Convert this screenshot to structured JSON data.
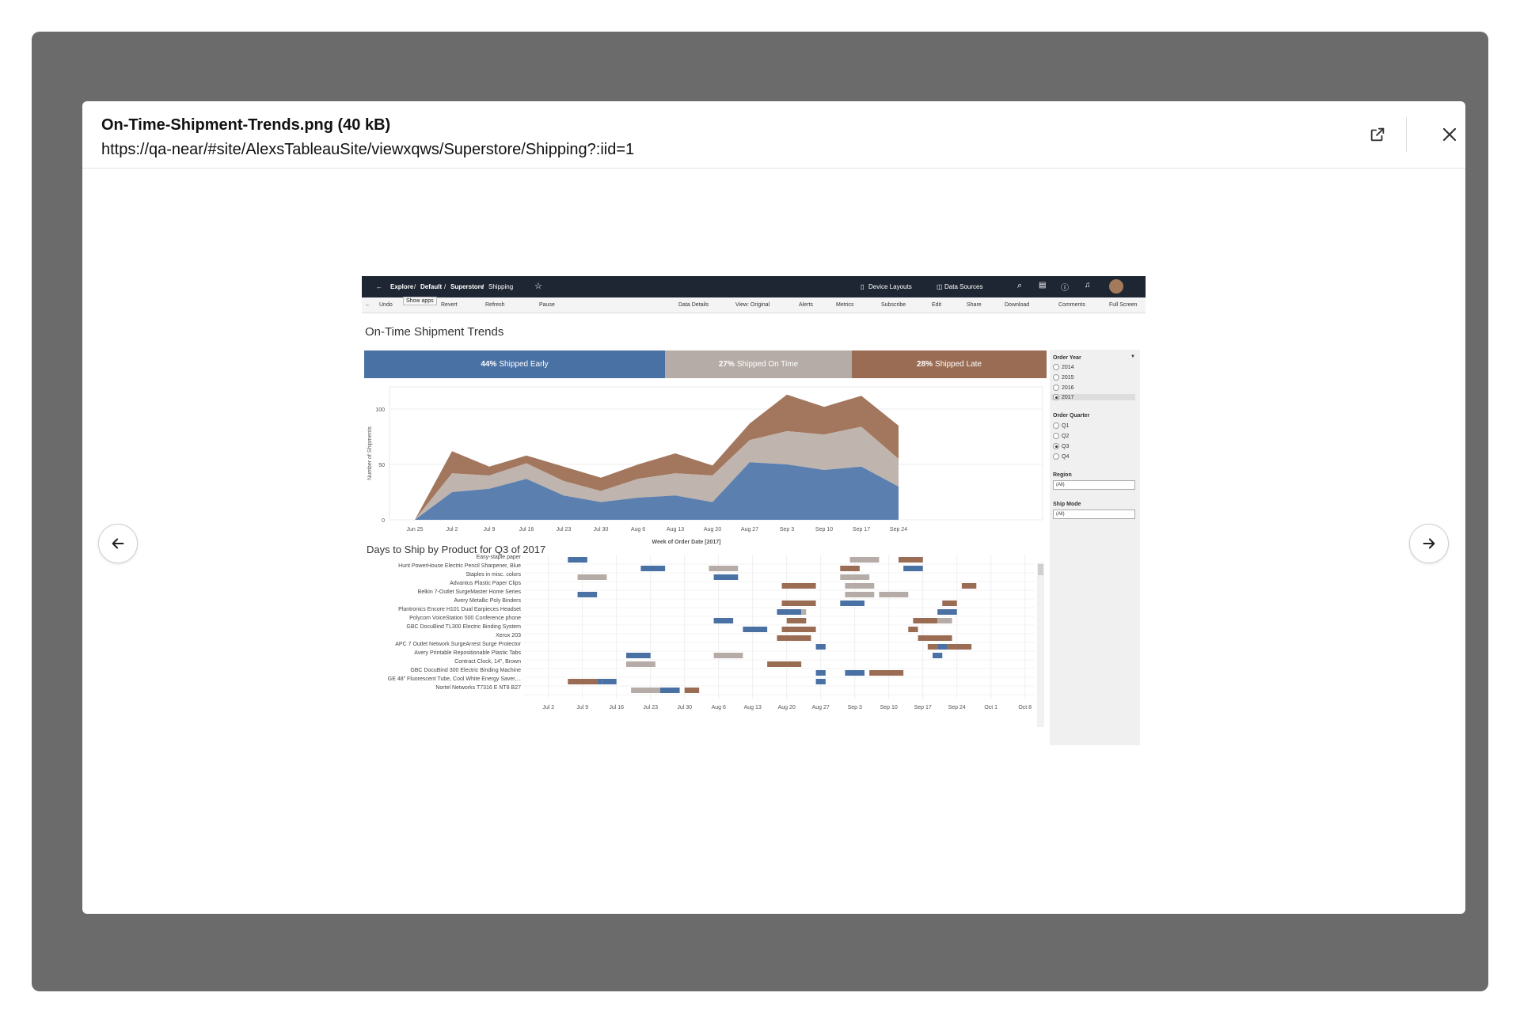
{
  "modal": {
    "file_title": "On-Time-Shipment-Trends.png (40 kB)",
    "file_url": "https://qa-near/#site/AlexsTableauSite/viewxqws/Superstore/Shipping?:iid=1"
  },
  "tableau": {
    "breadcrumb": [
      "Explore",
      "Default",
      "Superstore",
      "Shipping"
    ],
    "nav_right": [
      "Device Layouts",
      "Data Sources"
    ],
    "toolbar_left": [
      "Undo",
      "Revert",
      "Refresh",
      "Pause"
    ],
    "toolbar_right": [
      "Data Details",
      "View: Original",
      "Alerts",
      "Metrics",
      "Subscribe",
      "Edit",
      "Share",
      "Download",
      "Comments",
      "Full Screen"
    ],
    "tooltip": "Show apps",
    "view_title": "On-Time Shipment Trends",
    "kpis": [
      {
        "pct": "44%",
        "label": "Shipped Early",
        "color": "#4a71a4"
      },
      {
        "pct": "27%",
        "label": "Shipped On Time",
        "color": "#b6aca7"
      },
      {
        "pct": "28%",
        "label": "Shipped Late",
        "color": "#9a6c54"
      }
    ],
    "filters": {
      "order_year": {
        "label": "Order Year",
        "options": [
          "2014",
          "2015",
          "2016",
          "2017"
        ],
        "selected": "2017"
      },
      "order_quarter": {
        "label": "Order Quarter",
        "options": [
          "Q1",
          "Q2",
          "Q3",
          "Q4"
        ],
        "selected": "Q3"
      },
      "region": {
        "label": "Region",
        "value": "(All)"
      },
      "ship_mode": {
        "label": "Ship Mode",
        "value": "(All)"
      }
    },
    "gantt_title": "Days to Ship by Product for Q3 of 2017"
  },
  "chart_data": [
    {
      "type": "area",
      "xlabel": "Week of Order Date [2017]",
      "ylabel": "Number of Shipments",
      "ylim": [
        0,
        120
      ],
      "yticks": [
        0,
        50,
        100
      ],
      "x": [
        "Jun 25",
        "Jul 2",
        "Jul 9",
        "Jul 16",
        "Jul 23",
        "Jul 30",
        "Aug 6",
        "Aug 13",
        "Aug 20",
        "Aug 27",
        "Sep 3",
        "Sep 10",
        "Sep 17",
        "Sep 24"
      ],
      "stacked": true,
      "series": [
        {
          "name": "Shipped Early",
          "color": "#5b80b0",
          "values": [
            0,
            25,
            28,
            37,
            22,
            16,
            20,
            22,
            16,
            52,
            50,
            45,
            48,
            30
          ]
        },
        {
          "name": "Shipped On Time",
          "color": "#bfb4ae",
          "values": [
            0,
            17,
            12,
            14,
            13,
            10,
            17,
            20,
            24,
            20,
            30,
            32,
            36,
            25
          ]
        },
        {
          "name": "Shipped Late",
          "color": "#a3775e",
          "values": [
            0,
            20,
            8,
            7,
            13,
            12,
            13,
            18,
            9,
            15,
            33,
            25,
            28,
            30
          ]
        }
      ]
    },
    {
      "type": "bar",
      "subtype": "gantt",
      "title": "Days to Ship by Product for Q3 of 2017",
      "x_ticks": [
        "Jul 2",
        "Jul 9",
        "Jul 16",
        "Jul 23",
        "Jul 30",
        "Aug 6",
        "Aug 13",
        "Aug 20",
        "Aug 27",
        "Sep 3",
        "Sep 10",
        "Sep 17",
        "Sep 24",
        "Oct 1",
        "Oct 8"
      ],
      "x_start": "2017-06-27",
      "x_end": "2017-10-10",
      "status_colors": {
        "early": "#4a71a4",
        "on_time": "#b6aca7",
        "late": "#9a6c54"
      },
      "rows": [
        {
          "product": "Easy-staple paper",
          "bars": [
            {
              "start": "2017-07-06",
              "end": "2017-07-10",
              "status": "early"
            },
            {
              "start": "2017-09-02",
              "end": "2017-09-08",
              "status": "on_time"
            },
            {
              "start": "2017-09-12",
              "end": "2017-09-17",
              "status": "late"
            }
          ]
        },
        {
          "product": "Hunt PowerHouse Electric Pencil Sharpener, Blue",
          "bars": [
            {
              "start": "2017-07-21",
              "end": "2017-07-26",
              "status": "early"
            },
            {
              "start": "2017-08-04",
              "end": "2017-08-10",
              "status": "on_time"
            },
            {
              "start": "2017-08-31",
              "end": "2017-09-04",
              "status": "late"
            },
            {
              "start": "2017-09-13",
              "end": "2017-09-17",
              "status": "early"
            }
          ]
        },
        {
          "product": "Staples in misc. colors",
          "bars": [
            {
              "start": "2017-07-08",
              "end": "2017-07-14",
              "status": "on_time"
            },
            {
              "start": "2017-08-05",
              "end": "2017-08-10",
              "status": "early"
            },
            {
              "start": "2017-08-31",
              "end": "2017-09-06",
              "status": "on_time"
            }
          ]
        },
        {
          "product": "Advantus Plastic Paper Clips",
          "bars": [
            {
              "start": "2017-08-19",
              "end": "2017-08-26",
              "status": "late"
            },
            {
              "start": "2017-09-01",
              "end": "2017-09-07",
              "status": "on_time"
            },
            {
              "start": "2017-09-25",
              "end": "2017-09-28",
              "status": "late"
            }
          ]
        },
        {
          "product": "Belkin 7-Outlet SurgeMaster Home Series",
          "bars": [
            {
              "start": "2017-07-08",
              "end": "2017-07-12",
              "status": "early"
            },
            {
              "start": "2017-09-01",
              "end": "2017-09-07",
              "status": "on_time"
            },
            {
              "start": "2017-09-08",
              "end": "2017-09-14",
              "status": "on_time"
            }
          ]
        },
        {
          "product": "Avery Metallic Poly Binders",
          "bars": [
            {
              "start": "2017-08-19",
              "end": "2017-08-26",
              "status": "late"
            },
            {
              "start": "2017-08-31",
              "end": "2017-09-05",
              "status": "early"
            },
            {
              "start": "2017-09-21",
              "end": "2017-09-24",
              "status": "late"
            }
          ]
        },
        {
          "product": "Plantronics Encore H101 Dual Earpieces Headset",
          "bars": [
            {
              "start": "2017-08-18",
              "end": "2017-08-23",
              "status": "early"
            },
            {
              "start": "2017-08-23",
              "end": "2017-08-24",
              "status": "on_time"
            },
            {
              "start": "2017-09-20",
              "end": "2017-09-24",
              "status": "early"
            }
          ]
        },
        {
          "product": "Polycom VoiceStation 500 Conference phone",
          "bars": [
            {
              "start": "2017-08-05",
              "end": "2017-08-09",
              "status": "early"
            },
            {
              "start": "2017-08-20",
              "end": "2017-08-24",
              "status": "late"
            },
            {
              "start": "2017-09-15",
              "end": "2017-09-20",
              "status": "late"
            },
            {
              "start": "2017-09-20",
              "end": "2017-09-23",
              "status": "on_time"
            }
          ]
        },
        {
          "product": "GBC DocuBind TL300 Electric Binding System",
          "bars": [
            {
              "start": "2017-08-11",
              "end": "2017-08-16",
              "status": "early"
            },
            {
              "start": "2017-08-19",
              "end": "2017-08-26",
              "status": "late"
            },
            {
              "start": "2017-09-14",
              "end": "2017-09-16",
              "status": "late"
            }
          ]
        },
        {
          "product": "Xerox 203",
          "bars": [
            {
              "start": "2017-08-18",
              "end": "2017-08-25",
              "status": "late"
            },
            {
              "start": "2017-09-16",
              "end": "2017-09-23",
              "status": "late"
            }
          ]
        },
        {
          "product": "APC 7 Outlet Network SurgeArrest Surge Protector",
          "bars": [
            {
              "start": "2017-08-26",
              "end": "2017-08-28",
              "status": "early"
            },
            {
              "start": "2017-09-18",
              "end": "2017-09-20",
              "status": "late"
            },
            {
              "start": "2017-09-20",
              "end": "2017-09-22",
              "status": "early"
            },
            {
              "start": "2017-09-22",
              "end": "2017-09-27",
              "status": "late"
            }
          ]
        },
        {
          "product": "Avery Printable Repositionable Plastic Tabs",
          "bars": [
            {
              "start": "2017-07-18",
              "end": "2017-07-23",
              "status": "early"
            },
            {
              "start": "2017-08-05",
              "end": "2017-08-11",
              "status": "on_time"
            },
            {
              "start": "2017-09-19",
              "end": "2017-09-21",
              "status": "early"
            }
          ]
        },
        {
          "product": "Contract Clock, 14\", Brown",
          "bars": [
            {
              "start": "2017-07-18",
              "end": "2017-07-24",
              "status": "on_time"
            },
            {
              "start": "2017-08-16",
              "end": "2017-08-23",
              "status": "late"
            }
          ]
        },
        {
          "product": "GBC DocuBind 300 Electric Binding Machine",
          "bars": [
            {
              "start": "2017-08-26",
              "end": "2017-08-28",
              "status": "early"
            },
            {
              "start": "2017-09-01",
              "end": "2017-09-05",
              "status": "early"
            },
            {
              "start": "2017-09-06",
              "end": "2017-09-13",
              "status": "late"
            }
          ]
        },
        {
          "product": "GE 48\" Fluorescent Tube, Cool White Energy Saver,...",
          "bars": [
            {
              "start": "2017-07-06",
              "end": "2017-07-12",
              "status": "late"
            },
            {
              "start": "2017-07-12",
              "end": "2017-07-13",
              "status": "early"
            },
            {
              "start": "2017-07-13",
              "end": "2017-07-16",
              "status": "early"
            },
            {
              "start": "2017-08-26",
              "end": "2017-08-28",
              "status": "early"
            }
          ]
        },
        {
          "product": "Nortel Networks T7316 E NT8 B27",
          "bars": [
            {
              "start": "2017-07-19",
              "end": "2017-07-25",
              "status": "on_time"
            },
            {
              "start": "2017-07-25",
              "end": "2017-07-29",
              "status": "early"
            },
            {
              "start": "2017-07-30",
              "end": "2017-08-02",
              "status": "late"
            }
          ]
        }
      ]
    }
  ]
}
